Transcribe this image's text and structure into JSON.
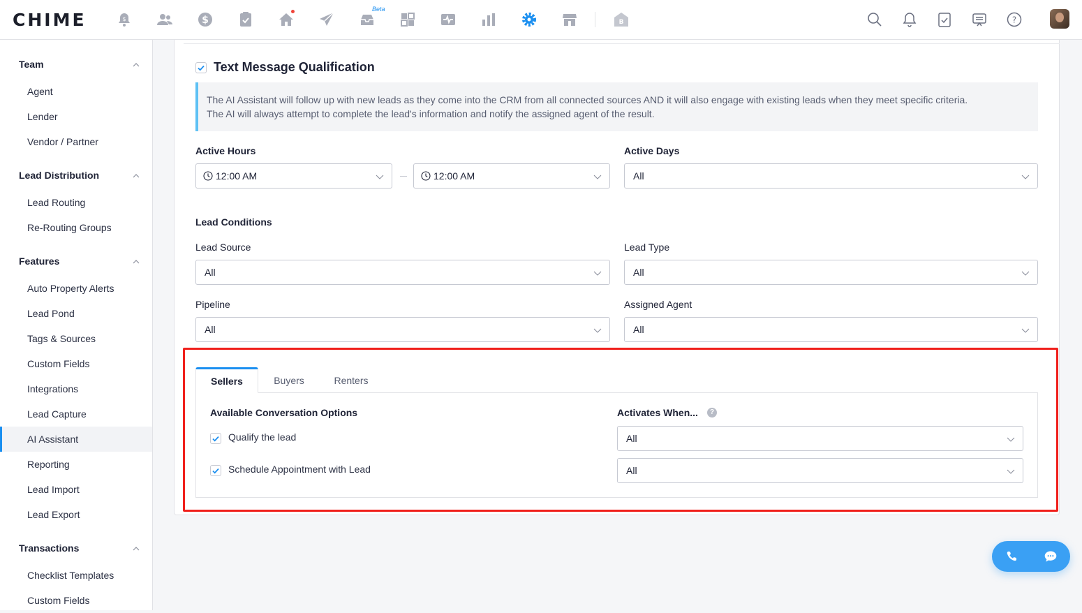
{
  "brand": {
    "logo_text": "CHIME"
  },
  "topnav": {
    "beta_label": "Beta",
    "icons": [
      "alert-bell-icon",
      "people-icon",
      "dollar-icon",
      "clipboard-check-icon",
      "home-icon",
      "send-icon",
      "inbox-icon",
      "grid-icon",
      "activity-icon",
      "bar-chart-icon",
      "settings-gear-icon",
      "store-icon",
      "building-b-icon"
    ],
    "right_icons": [
      "search-icon",
      "notification-bell-icon",
      "task-clipboard-icon",
      "message-icon",
      "help-icon"
    ]
  },
  "sidebar": {
    "sections": [
      {
        "title": "Team",
        "items": [
          "Agent",
          "Lender",
          "Vendor / Partner"
        ]
      },
      {
        "title": "Lead Distribution",
        "items": [
          "Lead Routing",
          "Re-Routing Groups"
        ]
      },
      {
        "title": "Features",
        "items": [
          "Auto Property Alerts",
          "Lead Pond",
          "Tags & Sources",
          "Custom Fields",
          "Integrations",
          "Lead Capture",
          "AI Assistant",
          "Reporting",
          "Lead Import",
          "Lead Export"
        ]
      },
      {
        "title": "Transactions",
        "items": [
          "Checklist Templates",
          "Custom Fields"
        ]
      }
    ],
    "active_item": "AI Assistant"
  },
  "qualification": {
    "enabled": true,
    "title": "Text Message Qualification",
    "info_line1": "The AI Assistant will follow up with new leads as they come into the CRM from all connected sources AND it will also engage with existing leads when they meet specific criteria.",
    "info_line2": "The AI will always attempt to complete the lead's information and notify the assigned agent of the result."
  },
  "active_hours": {
    "label": "Active Hours",
    "start": "12:00 AM",
    "end": "12:00 AM"
  },
  "active_days": {
    "label": "Active Days",
    "value": "All"
  },
  "lead_conditions": {
    "title": "Lead Conditions",
    "lead_source": {
      "label": "Lead Source",
      "value": "All"
    },
    "lead_type": {
      "label": "Lead Type",
      "value": "All"
    },
    "pipeline": {
      "label": "Pipeline",
      "value": "All"
    },
    "assigned_agent": {
      "label": "Assigned Agent",
      "value": "All"
    }
  },
  "tabs": {
    "items": [
      "Sellers",
      "Buyers",
      "Renters"
    ],
    "active": "Sellers"
  },
  "conversation": {
    "options_title": "Available Conversation Options",
    "activates_title": "Activates When...",
    "help_glyph": "?",
    "options": [
      {
        "label": "Qualify the lead",
        "checked": true,
        "activates": "All"
      },
      {
        "label": "Schedule Appointment with Lead",
        "checked": true,
        "activates": "All"
      }
    ]
  },
  "colors": {
    "accent": "#1b8ff0",
    "highlight_border": "#f0201c",
    "info_bar": "#5ec1f4"
  }
}
